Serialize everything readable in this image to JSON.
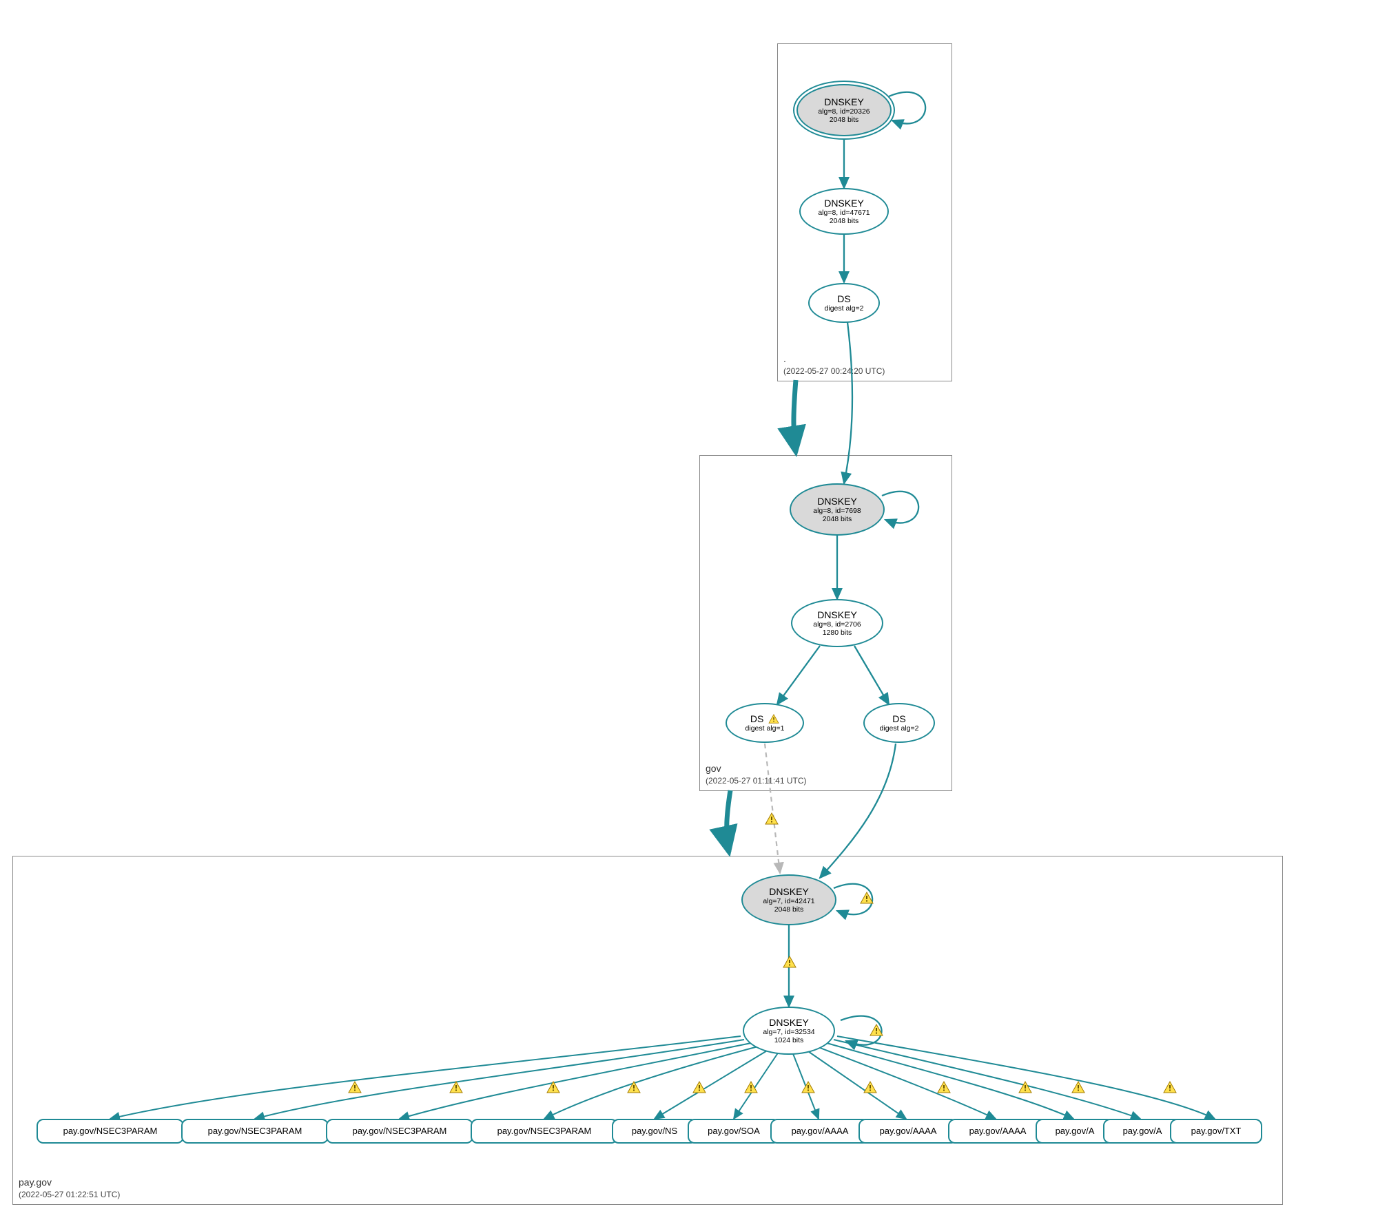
{
  "colors": {
    "stroke": "#1f8a95",
    "gray": "#b8b8b8",
    "zone_border": "#888888",
    "ksk_fill": "#d9d9d9",
    "warn_fill": "#ffe14d",
    "warn_stroke": "#a37b00"
  },
  "zones": {
    "root": {
      "label": ".",
      "timestamp": "(2022-05-27 00:24:20 UTC)"
    },
    "gov": {
      "label": "gov",
      "timestamp": "(2022-05-27 01:11:41 UTC)"
    },
    "paygov": {
      "label": "pay.gov",
      "timestamp": "(2022-05-27 01:22:51 UTC)"
    }
  },
  "nodes": {
    "root_ksk": {
      "title": "DNSKEY",
      "line2": "alg=8, id=20326",
      "line3": "2048 bits"
    },
    "root_zsk": {
      "title": "DNSKEY",
      "line2": "alg=8, id=47671",
      "line3": "2048 bits"
    },
    "root_ds": {
      "title": "DS",
      "line2": "digest alg=2"
    },
    "gov_ksk": {
      "title": "DNSKEY",
      "line2": "alg=8, id=7698",
      "line3": "2048 bits"
    },
    "gov_zsk": {
      "title": "DNSKEY",
      "line2": "alg=8, id=2706",
      "line3": "1280 bits"
    },
    "gov_ds1": {
      "title": "DS",
      "line2": "digest alg=1",
      "warn": true
    },
    "gov_ds2": {
      "title": "DS",
      "line2": "digest alg=2"
    },
    "pg_ksk": {
      "title": "DNSKEY",
      "line2": "alg=7, id=42471",
      "line3": "2048 bits"
    },
    "pg_zsk": {
      "title": "DNSKEY",
      "line2": "alg=7, id=32534",
      "line3": "1024 bits"
    }
  },
  "rrsets": {
    "r0": "pay.gov/NSEC3PARAM",
    "r1": "pay.gov/NSEC3PARAM",
    "r2": "pay.gov/NSEC3PARAM",
    "r3": "pay.gov/NSEC3PARAM",
    "r4": "pay.gov/NS",
    "r5": "pay.gov/SOA",
    "r6": "pay.gov/AAAA",
    "r7": "pay.gov/AAAA",
    "r8": "pay.gov/AAAA",
    "r9": "pay.gov/A",
    "r10": "pay.gov/A",
    "r11": "pay.gov/TXT"
  }
}
